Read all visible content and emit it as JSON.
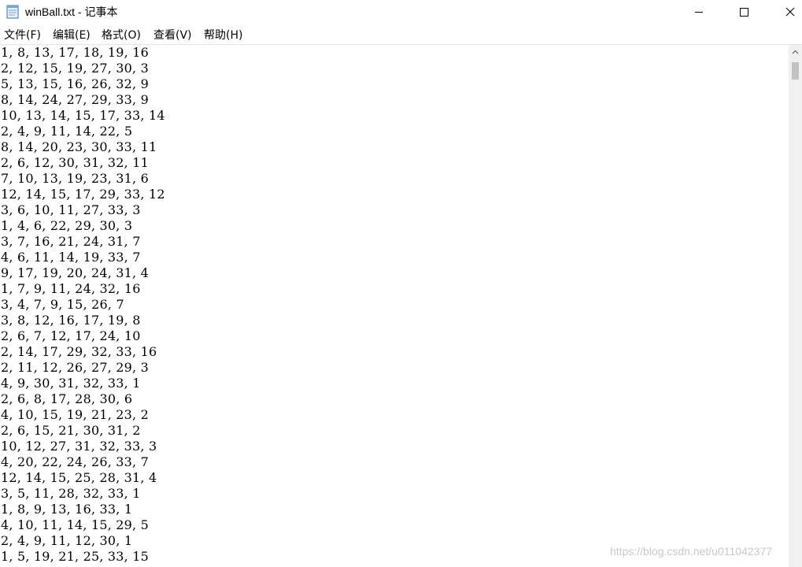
{
  "window": {
    "title": "winBall.txt - 记事本",
    "minimize_glyph": "—",
    "maximize_glyph": "☐",
    "close_glyph": "✕"
  },
  "menu": {
    "file": "文件(F)",
    "edit": "编辑(E)",
    "format": "格式(O)",
    "view": "查看(V)",
    "help": "帮助(H)"
  },
  "lines": [
    "1, 8, 13, 17, 18, 19, 16",
    "2, 12, 15, 19, 27, 30, 3",
    "5, 13, 15, 16, 26, 32, 9",
    "8, 14, 24, 27, 29, 33, 9",
    "10, 13, 14, 15, 17, 33, 14",
    "2, 4, 9, 11, 14, 22, 5",
    "8, 14, 20, 23, 30, 33, 11",
    "2, 6, 12, 30, 31, 32, 11",
    "7, 10, 13, 19, 23, 31, 6",
    "12, 14, 15, 17, 29, 33, 12",
    "3, 6, 10, 11, 27, 33, 3",
    "1, 4, 6, 22, 29, 30, 3",
    "3, 7, 16, 21, 24, 31, 7",
    "4, 6, 11, 14, 19, 33, 7",
    "9, 17, 19, 20, 24, 31, 4",
    "1, 7, 9, 11, 24, 32, 16",
    "3, 4, 7, 9, 15, 26, 7",
    "3, 8, 12, 16, 17, 19, 8",
    "2, 6, 7, 12, 17, 24, 10",
    "2, 14, 17, 29, 32, 33, 16",
    "2, 11, 12, 26, 27, 29, 3",
    "4, 9, 30, 31, 32, 33, 1",
    "2, 6, 8, 17, 28, 30, 6",
    "4, 10, 15, 19, 21, 23, 2",
    "2, 6, 15, 21, 30, 31, 2",
    "10, 12, 27, 31, 32, 33, 3",
    "4, 20, 22, 24, 26, 33, 7",
    "12, 14, 15, 25, 28, 31, 4",
    "3, 5, 11, 28, 32, 33, 1",
    "1, 8, 9, 13, 16, 33, 1",
    "4, 10, 11, 14, 15, 29, 5",
    "2, 4, 9, 11, 12, 30, 1",
    "1, 5, 19, 21, 25, 33, 15"
  ],
  "watermark": "https://blog.csdn.net/u011042377",
  "colors": {
    "text": "#000000",
    "background": "#ffffff",
    "divider": "#dfe6ef",
    "scroll_track": "#f0f0f0",
    "scroll_thumb": "#c2c2c2"
  }
}
